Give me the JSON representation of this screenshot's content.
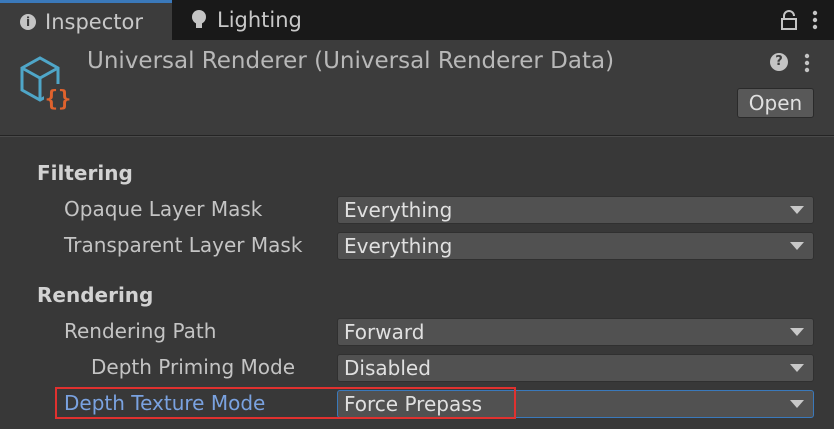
{
  "tabs": [
    {
      "label": "Inspector",
      "icon": "info-icon",
      "active": true
    },
    {
      "label": "Lighting",
      "icon": "bulb-icon",
      "active": false
    }
  ],
  "header": {
    "title": "Universal Renderer (Universal Renderer Data)",
    "icon": "scriptable-object-icon",
    "open_label": "Open"
  },
  "sections": {
    "filtering": {
      "title": "Filtering",
      "opaque_label": "Opaque Layer Mask",
      "opaque_value": "Everything",
      "transparent_label": "Transparent Layer Mask",
      "transparent_value": "Everything"
    },
    "rendering": {
      "title": "Rendering",
      "path_label": "Rendering Path",
      "path_value": "Forward",
      "priming_label": "Depth Priming Mode",
      "priming_value": "Disabled",
      "depth_texture_label": "Depth Texture Mode",
      "depth_texture_value": "Force Prepass"
    }
  },
  "colors": {
    "accent": "#3a79bb",
    "highlight_label": "#7aa2e0",
    "annotation": "#e0312f"
  }
}
